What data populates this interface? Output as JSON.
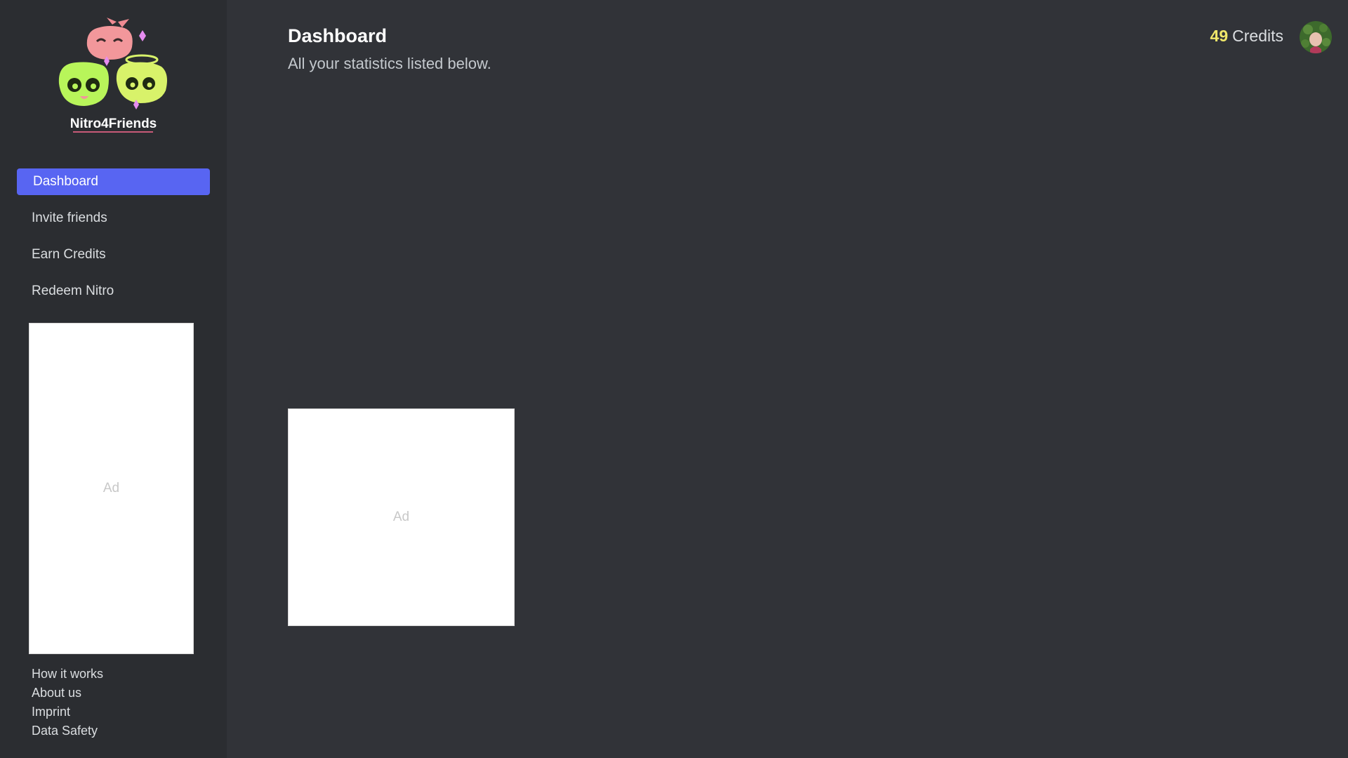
{
  "brand": {
    "name": "Nitro4Friends",
    "logo_icon": "nitro4friends-logo-icon",
    "accent_color": "#5865f2",
    "underline_color": "#c85a78"
  },
  "sidebar": {
    "items": [
      {
        "label": "Dashboard",
        "active": true
      },
      {
        "label": "Invite friends",
        "active": false
      },
      {
        "label": "Earn Credits",
        "active": false
      },
      {
        "label": "Redeem Nitro",
        "active": false
      }
    ],
    "ad_label": "Ad",
    "footer_links": [
      {
        "label": "How it works"
      },
      {
        "label": "About us"
      },
      {
        "label": "Imprint"
      },
      {
        "label": "Data Safety"
      }
    ]
  },
  "header": {
    "title": "Dashboard",
    "subtitle": "All your statistics listed below.",
    "credits_count": "49",
    "credits_label": "Credits",
    "credits_color": "#f0e76a",
    "avatar_icon": "user-avatar"
  },
  "main": {
    "ad_label": "Ad"
  }
}
